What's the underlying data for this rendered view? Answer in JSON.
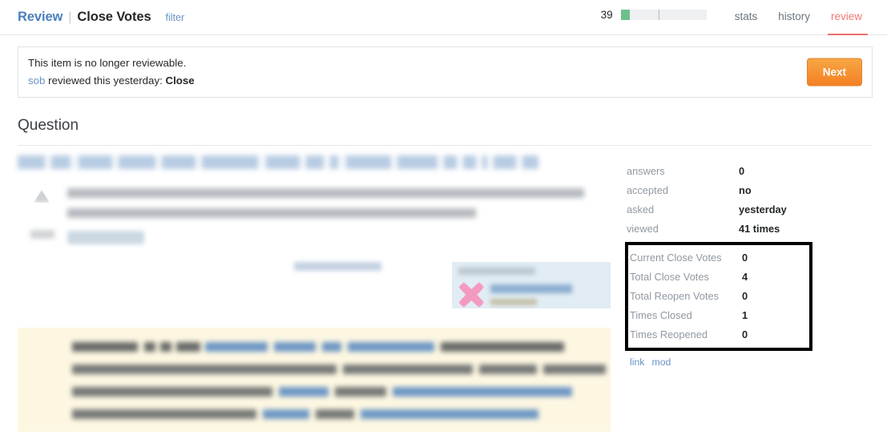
{
  "header": {
    "breadcrumb_root": "Review",
    "breadcrumb_separator": "|",
    "breadcrumb_current": "Close Votes",
    "filter_label": "filter",
    "progress_count": "39",
    "tabs": [
      {
        "label": "stats",
        "active": false
      },
      {
        "label": "history",
        "active": false
      },
      {
        "label": "review",
        "active": true
      }
    ],
    "accent_color": "#ef6f6c",
    "progress_fill_color": "#6cc08b"
  },
  "banner": {
    "line1": "This item is no longer reviewable.",
    "reviewer": "sob",
    "line2_middle": " reviewed this yesterday: ",
    "action": "Close",
    "next_label": "Next",
    "next_color": "#f48024"
  },
  "question": {
    "section_title": "Question"
  },
  "stats": {
    "rows": [
      {
        "label": "answers",
        "value": "0"
      },
      {
        "label": "accepted",
        "value": "no"
      },
      {
        "label": "asked",
        "value": "yesterday"
      },
      {
        "label": "viewed",
        "value": "41 times"
      }
    ],
    "highlighted_rows": [
      {
        "label": "Current Close Votes",
        "value": "0"
      },
      {
        "label": "Total Close Votes",
        "value": "4"
      },
      {
        "label": "Total Reopen Votes",
        "value": "0"
      },
      {
        "label": "Times Closed",
        "value": "1"
      },
      {
        "label": "Times Reopened",
        "value": "0"
      }
    ],
    "highlight_border_color": "#000000",
    "links": [
      {
        "label": "link"
      },
      {
        "label": "mod"
      }
    ]
  }
}
